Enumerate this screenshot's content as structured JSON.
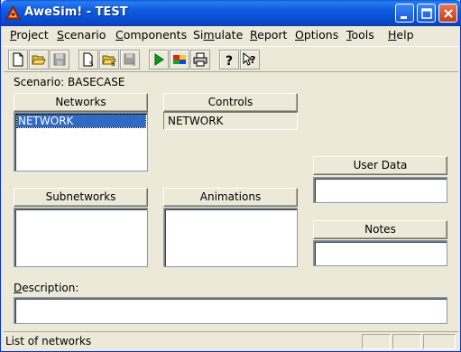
{
  "window": {
    "title": "AweSim! - TEST",
    "icon": "awesim-app-icon"
  },
  "menu": [
    {
      "label": "Project",
      "accel": "P"
    },
    {
      "label": "Scenario",
      "accel": "S"
    },
    {
      "label": "Components",
      "accel": "C"
    },
    {
      "label": "Simulate",
      "accel": "m"
    },
    {
      "label": "Report",
      "accel": "R"
    },
    {
      "label": "Options",
      "accel": "O"
    },
    {
      "label": "Tools",
      "accel": "T"
    },
    {
      "label": "Help",
      "accel": "H"
    }
  ],
  "toolbar": {
    "buttons": [
      "new-icon",
      "open-icon",
      "save-icon",
      "new-scenario-icon",
      "open-scenario-icon",
      "save-scenario-icon",
      "run-icon",
      "report-icon",
      "print-icon",
      "help-icon",
      "context-help-icon"
    ]
  },
  "scenario": {
    "label": "Scenario: BASECASE"
  },
  "networks": {
    "header": "Networks",
    "items": [
      "NETWORK"
    ],
    "selected": 0
  },
  "controls": {
    "header": "Controls",
    "value": "NETWORK"
  },
  "user_data": {
    "header": "User Data",
    "value": ""
  },
  "subnetworks": {
    "header": "Subnetworks",
    "items": []
  },
  "animations": {
    "header": "Animations",
    "items": []
  },
  "notes": {
    "header": "Notes",
    "value": ""
  },
  "description": {
    "label": "Description:",
    "value": ""
  },
  "status": {
    "text": "List of networks"
  }
}
